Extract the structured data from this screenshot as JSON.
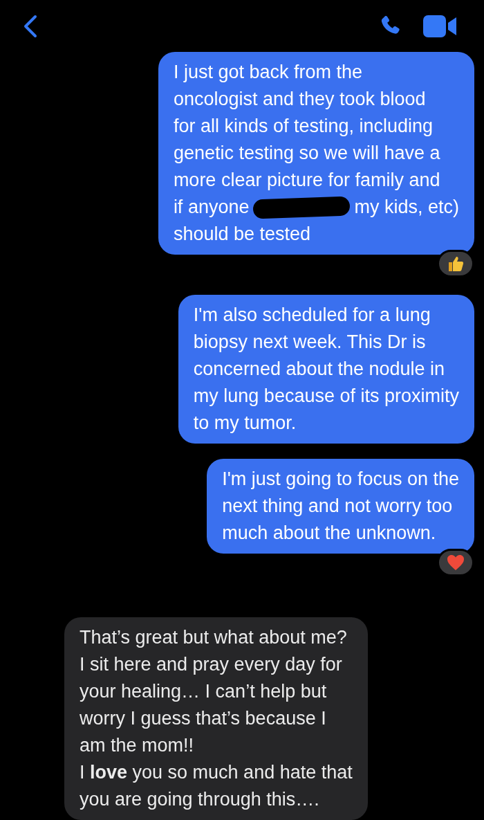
{
  "header": {
    "actions": [
      {
        "kind": "phone"
      },
      {
        "kind": "video"
      }
    ]
  },
  "messages": [
    {
      "kind": "outgoing",
      "reaction": {
        "kind": "thumbs-up"
      },
      "lines": [
        {
          "text": "I just got back from the"
        },
        {
          "text": "oncologist and they took blood"
        },
        {
          "text": "for all kinds of testing, including"
        },
        {
          "text": "genetic testing so we will have a"
        },
        {
          "text": "more clear picture for family and"
        },
        {
          "kind": "redacted",
          "before": "if anyone",
          "after": "my kids, etc)"
        },
        {
          "text": "should be tested"
        }
      ]
    },
    {
      "kind": "outgoing",
      "lines": [
        {
          "text": "I'm also scheduled for a lung"
        },
        {
          "text": "biopsy next week. This Dr is"
        },
        {
          "text": "concerned about the nodule in"
        },
        {
          "text": "my lung because of its proximity"
        },
        {
          "text": "to my tumor."
        }
      ]
    },
    {
      "kind": "outgoing",
      "reaction": {
        "kind": "heart"
      },
      "lines": [
        {
          "text": "I'm just going to focus on the"
        },
        {
          "text": "next thing and not worry too"
        },
        {
          "text": "much about the unknown."
        }
      ]
    },
    {
      "kind": "incoming",
      "lines": [
        {
          "text": "That’s great but what about me?"
        },
        {
          "text": "I sit here and pray every day for"
        },
        {
          "text": "your healing… I can’t help but"
        },
        {
          "text": "worry I guess that’s because I"
        },
        {
          "text": "am the mom!!"
        },
        {
          "text": "I **love** you so much and hate that"
        },
        {
          "text": "you are going through this…."
        }
      ]
    }
  ]
}
